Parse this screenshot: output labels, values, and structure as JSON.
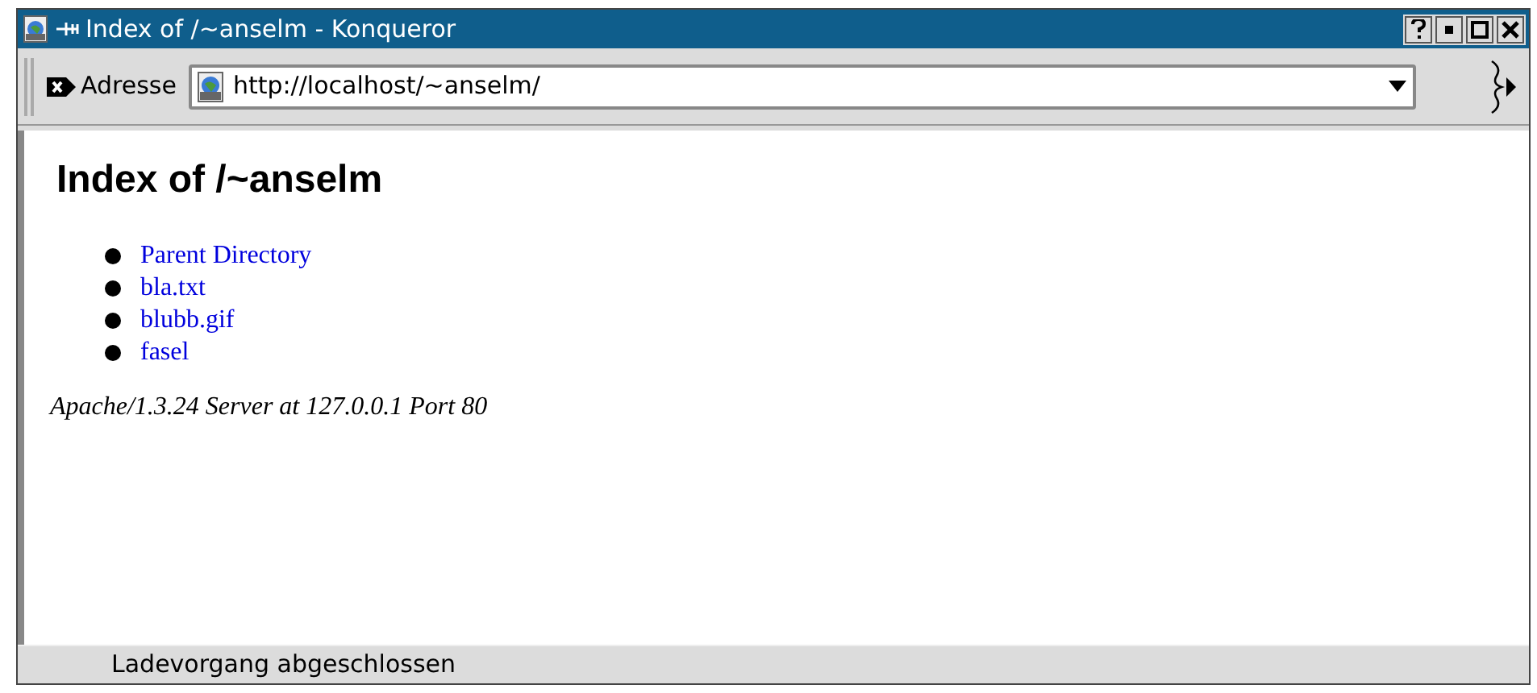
{
  "window": {
    "title": "Index of /~anselm - Konqueror"
  },
  "location_bar": {
    "label": "Adresse",
    "value": "http://localhost/~anselm/"
  },
  "page": {
    "heading": "Index of /~anselm",
    "links": [
      {
        "text": "Parent Directory"
      },
      {
        "text": "bla.txt"
      },
      {
        "text": "blubb.gif"
      },
      {
        "text": "fasel"
      }
    ],
    "footer": "Apache/1.3.24 Server at 127.0.0.1 Port 80"
  },
  "status_bar": {
    "text": "Ladevorgang abgeschlossen"
  }
}
